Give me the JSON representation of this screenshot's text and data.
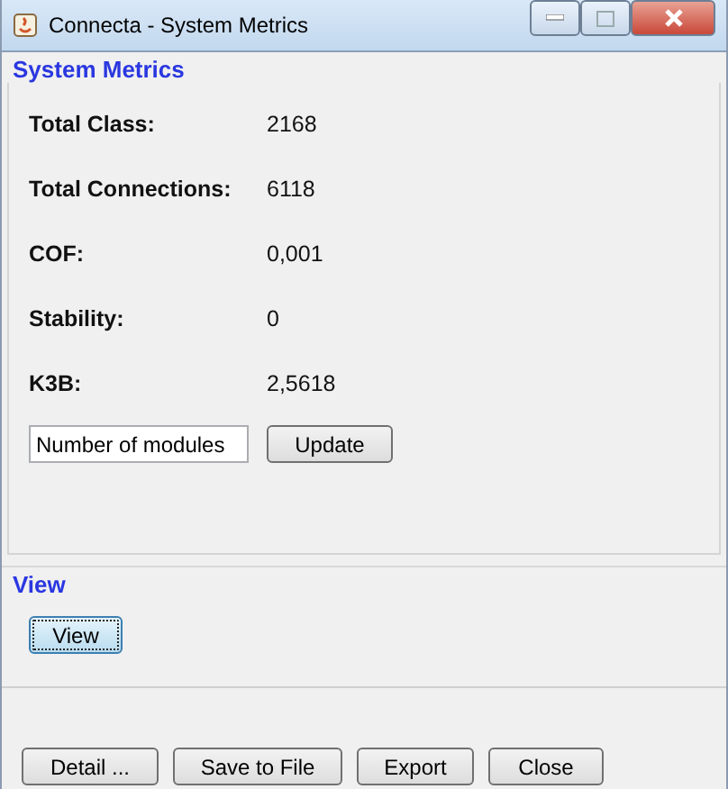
{
  "window": {
    "title": "Connecta - System Metrics"
  },
  "system_metrics": {
    "heading": "System Metrics",
    "metrics": [
      {
        "label": "Total Class:",
        "value": "2168"
      },
      {
        "label": "Total Connections:",
        "value": "6118"
      },
      {
        "label": "COF:",
        "value": "0,001"
      },
      {
        "label": "Stability:",
        "value": "0"
      },
      {
        "label": "K3B:",
        "value": "2,5618"
      }
    ],
    "modules_field": {
      "value": "Number of modules"
    },
    "update_button": "Update"
  },
  "view": {
    "heading": "View",
    "button": {
      "label": "View",
      "focused": true
    }
  },
  "buttons": [
    "Detail ...",
    "Save to File",
    "Export",
    "Close"
  ]
}
